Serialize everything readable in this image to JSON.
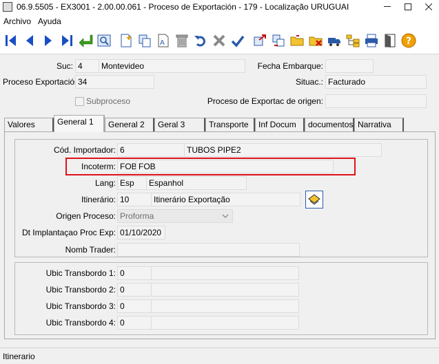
{
  "window": {
    "title": "06.9.5505 - EX3001 - 2.00.00.061 - Proceso de Exportación - 179 - Localização URUGUAI"
  },
  "menu": [
    "Archivo",
    "Ayuda"
  ],
  "toolbar": {
    "icons": [
      "first-icon",
      "prev-icon",
      "next-icon",
      "last-icon",
      "goto-icon",
      "search-icon",
      "new-icon",
      "copy-icon",
      "edit-icon",
      "delete-icon",
      "undo-icon",
      "cancel-icon",
      "confirm-icon",
      "export-icon",
      "transfer-icon",
      "folder-icon",
      "folder-delete-icon",
      "truck-icon",
      "tree-icon",
      "print-icon",
      "exit-icon",
      "help-icon"
    ]
  },
  "header": {
    "suc_label": "Suc:",
    "suc_code": "4",
    "suc_name": "Montevideo",
    "fecha_label": "Fecha Embarque:",
    "fecha_value": "",
    "proceso_label": "Proceso Exportación:",
    "proceso_value": "34",
    "situac_label": "Situac.:",
    "situac_value": "Facturado",
    "subproceso_label": "Subproceso",
    "origen_label": "Proceso de Exportac de origen:",
    "origen_value": ""
  },
  "tabs": [
    {
      "label": "Valores"
    },
    {
      "label": "General 1"
    },
    {
      "label": "General 2"
    },
    {
      "label": "Geral 3"
    },
    {
      "label": "Transporte"
    },
    {
      "label": "Inf Docum"
    },
    {
      "label": "documentos"
    },
    {
      "label": "Narrativa"
    }
  ],
  "general1": {
    "importador_label": "Cód. Importador:",
    "importador_code": "6",
    "importador_name": "TUBOS PIPE2",
    "incoterm_label": "Incoterm:",
    "incoterm_code": "FOB",
    "incoterm_name": "FOB",
    "lang_label": "Lang:",
    "lang_code": "Esp",
    "lang_name": "Espanhol",
    "itinerario_label": "Itinerário:",
    "itinerario_code": "10",
    "itinerario_name": "Itinerário Exportação",
    "origen_label": "Origen Proceso:",
    "origen_value": "Proforma",
    "dt_label": "Dt Implantaçao Proc Exp:",
    "dt_value": "01/10/2020",
    "trader_label": "Nomb Trader:",
    "trader_value": ""
  },
  "transbordo": [
    {
      "label": "Ubic Transbordo 1:",
      "code": "0",
      "name": ""
    },
    {
      "label": "Ubic Transbordo 2:",
      "code": "0",
      "name": ""
    },
    {
      "label": "Ubic Transbordo 3:",
      "code": "0",
      "name": ""
    },
    {
      "label": "Ubic Transbordo 4:",
      "code": "0",
      "name": ""
    }
  ],
  "status": {
    "text": "Itinerario"
  }
}
